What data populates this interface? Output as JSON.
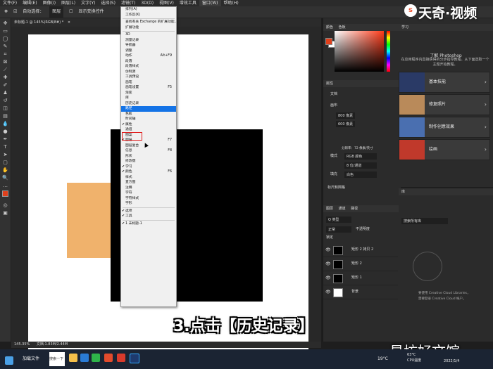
{
  "menubar": {
    "items": [
      "文件(F)",
      "编辑(E)",
      "图像(I)",
      "图层(L)",
      "文字(Y)",
      "选择(S)",
      "滤镜(T)",
      "3D(D)",
      "视图(V)",
      "增效工具",
      "窗口(W)",
      "帮助(H)"
    ],
    "active_index": 10
  },
  "optbar": {
    "auto_select": "自动选择：",
    "layer_select": "图层",
    "transform": "显示变换控件"
  },
  "tab": {
    "label": "未标题-1 @ 145%(RGB/8#) *"
  },
  "window_menu": {
    "items": [
      {
        "label": "排列(A)",
        "shortcut": "",
        "check": false
      },
      {
        "label": "工作区(K)",
        "shortcut": "",
        "check": false
      },
      {
        "sep": true
      },
      {
        "label": "查找有关 Exchange 的扩展功能...",
        "shortcut": "",
        "check": false
      },
      {
        "label": "扩展功能",
        "shortcut": "",
        "check": false
      },
      {
        "sep": true
      },
      {
        "label": "3D",
        "shortcut": "",
        "check": false
      },
      {
        "label": "测量记录",
        "shortcut": "",
        "check": false
      },
      {
        "label": "导航器",
        "shortcut": "",
        "check": false
      },
      {
        "label": "调整",
        "shortcut": "",
        "check": false
      },
      {
        "label": "动作",
        "shortcut": "Alt+F9",
        "check": false
      },
      {
        "label": "段落",
        "shortcut": "",
        "check": false
      },
      {
        "label": "段落样式",
        "shortcut": "",
        "check": false
      },
      {
        "label": "仿制源",
        "shortcut": "",
        "check": false
      },
      {
        "label": "工具预设",
        "shortcut": "",
        "check": false
      },
      {
        "label": "画笔",
        "shortcut": "",
        "check": false
      },
      {
        "label": "画笔设置",
        "shortcut": "F5",
        "check": false
      },
      {
        "label": "渐变",
        "shortcut": "",
        "check": false
      },
      {
        "label": "库",
        "shortcut": "",
        "check": false
      },
      {
        "label": "历史记录",
        "shortcut": "",
        "check": false
      },
      {
        "label": "路径",
        "shortcut": "",
        "check": false,
        "hl": true
      },
      {
        "label": "色板",
        "shortcut": "",
        "check": false
      },
      {
        "label": "时间轴",
        "shortcut": "",
        "check": false
      },
      {
        "label": "属性",
        "shortcut": "",
        "check": true
      },
      {
        "label": "通道",
        "shortcut": "",
        "check": false
      },
      {
        "label": "图案",
        "shortcut": "",
        "check": false
      },
      {
        "label": "图层",
        "shortcut": "F7",
        "check": true
      },
      {
        "label": "图层复合",
        "shortcut": "",
        "check": false
      },
      {
        "label": "信息",
        "shortcut": "F8",
        "check": false
      },
      {
        "label": "形状",
        "shortcut": "",
        "check": false
      },
      {
        "label": "修改键",
        "shortcut": "",
        "check": false
      },
      {
        "label": "学习",
        "shortcut": "",
        "check": true
      },
      {
        "label": "颜色",
        "shortcut": "F6",
        "check": true
      },
      {
        "label": "样式",
        "shortcut": "",
        "check": false
      },
      {
        "label": "直方图",
        "shortcut": "",
        "check": false
      },
      {
        "label": "注释",
        "shortcut": "",
        "check": false
      },
      {
        "label": "字符",
        "shortcut": "",
        "check": false
      },
      {
        "label": "字符样式",
        "shortcut": "",
        "check": false
      },
      {
        "label": "字形",
        "shortcut": "",
        "check": false
      },
      {
        "sep": true
      },
      {
        "label": "选项",
        "shortcut": "",
        "check": true
      },
      {
        "label": "工具",
        "shortcut": "",
        "check": true
      },
      {
        "sep": true
      },
      {
        "label": "1 未标题-1",
        "shortcut": "",
        "check": true
      }
    ]
  },
  "panels": {
    "color_tab": "颜色",
    "swatches_tab": "色板",
    "properties_tab": "属性",
    "doc_label": "文档",
    "canvas_label": "画布",
    "width": "800 像素",
    "height": "600 像素",
    "resolution": "分辨率：72 像素/英寸",
    "mode_label": "模式",
    "mode_value": "RGB 颜色",
    "depth_value": "8 位/通道",
    "fill_label": "填充",
    "fill_value": "白色",
    "rulers_label": "标尺和网格",
    "layers_tab": "图层",
    "channels_tab": "通道",
    "paths_tab": "路径",
    "kind": "Q 类型",
    "blend": "正常",
    "opacity": "不透明度",
    "lock": "锁定"
  },
  "layers": [
    {
      "name": "矩形 2 拷贝 2"
    },
    {
      "name": "矩形 2"
    },
    {
      "name": "矩形 1"
    },
    {
      "name": "背景"
    }
  ],
  "learn": {
    "tab": "学习",
    "title": "了解 Photoshop",
    "subtitle": "在应用程序内直接获得的分步指导教程。从下面选取一个主题开始教程。",
    "cards": [
      {
        "label": "基本技能",
        "color": "#2a3a66"
      },
      {
        "label": "修复照片",
        "color": "#b98a5a"
      },
      {
        "label": "制作创意效果",
        "color": "#4a6fb0"
      },
      {
        "label": "绘画",
        "color": "#c0392b"
      }
    ]
  },
  "library": {
    "tab": "库",
    "search": "搜索所有库",
    "note1": "要使用 Creative Cloud Libraries，",
    "note2": "需要登录 Creative Cloud 帐户。"
  },
  "status": {
    "zoom": "145.35%",
    "doc": "文档:1.83M/2.44M"
  },
  "subtitle": "3.点击【历史记录】",
  "watermark_top": "天奇·视频",
  "watermark_bottom": "易坊好文馆",
  "taskbar": {
    "app1": "加载文件",
    "search": "搜索一下",
    "weather": "19°C",
    "cpu_temp": "63°C",
    "cpu_label": "CPU温度",
    "date": "2022/1/4"
  }
}
